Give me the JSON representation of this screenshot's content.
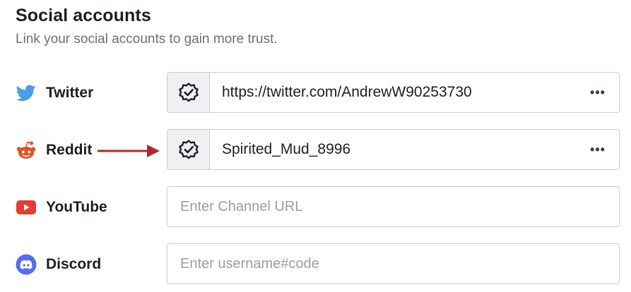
{
  "header": {
    "title": "Social accounts",
    "subtitle": "Link your social accounts to gain more trust."
  },
  "accounts": [
    {
      "platform": "Twitter",
      "icon": "twitter-bird-icon",
      "color": "#4a9ee3",
      "verified": true,
      "value": "https://twitter.com/AndrewW90253730",
      "menu": "•••"
    },
    {
      "platform": "Reddit",
      "icon": "reddit-alien-icon",
      "color": "#e0542a",
      "verified": true,
      "value": "Spirited_Mud_8996",
      "menu": "•••"
    },
    {
      "platform": "YouTube",
      "icon": "youtube-play-icon",
      "color": "#e53b30",
      "verified": false,
      "placeholder": "Enter Channel URL",
      "value": ""
    },
    {
      "platform": "Discord",
      "icon": "discord-icon",
      "color": "#5a6ce8",
      "verified": false,
      "placeholder": "Enter username#code",
      "value": ""
    }
  ],
  "annotation": {
    "arrow_color": "#b2282c"
  }
}
